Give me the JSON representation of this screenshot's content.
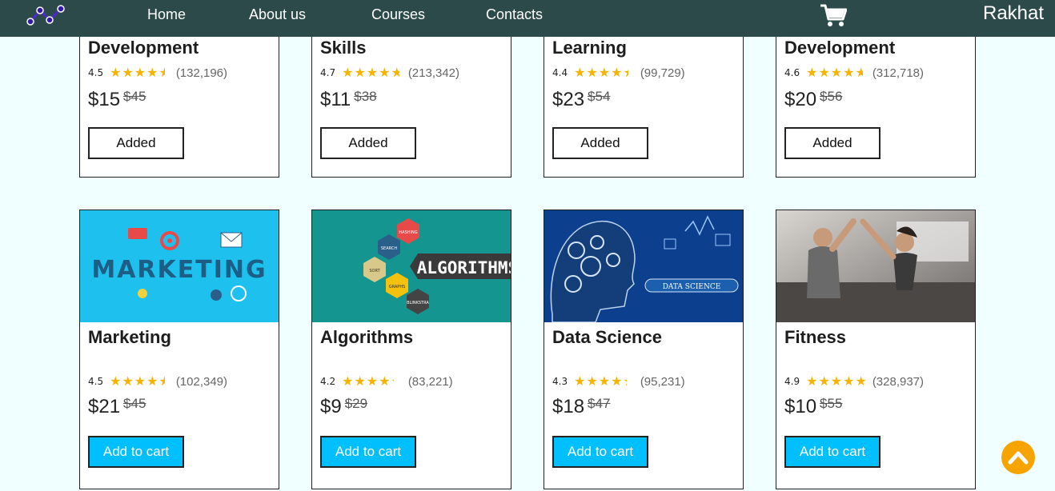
{
  "nav": {
    "logo_icon": "network-nodes-logo",
    "links": [
      "Home",
      "About us",
      "Courses",
      "Contacts"
    ],
    "cart_icon": "shopping-cart-icon",
    "user": "Rakhat"
  },
  "colors": {
    "navbar": "#2d4a4a",
    "page_bg": "#f0ffff",
    "star": "#f5b400",
    "add_button": "#00bfff",
    "scroll_button": "#f6a400"
  },
  "top_cards": [
    {
      "title": "Development",
      "rating": "4.5",
      "rating_value": 4.5,
      "count": "(132,196)",
      "price": "$15",
      "old_price": "$45",
      "button": "Added"
    },
    {
      "title": "Skills",
      "rating": "4.7",
      "rating_value": 4.7,
      "count": "(213,342)",
      "price": "$11",
      "old_price": "$38",
      "button": "Added"
    },
    {
      "title": "Learning",
      "rating": "4.4",
      "rating_value": 4.4,
      "count": "(99,729)",
      "price": "$23",
      "old_price": "$54",
      "button": "Added"
    },
    {
      "title": "Development",
      "rating": "4.6",
      "rating_value": 4.6,
      "count": "(312,718)",
      "price": "$20",
      "old_price": "$56",
      "button": "Added"
    }
  ],
  "bottom_cards": [
    {
      "image": "marketing-thumbnail",
      "image_text": "MARKETING",
      "title": "Marketing",
      "rating": "4.5",
      "rating_value": 4.5,
      "count": "(102,349)",
      "price": "$21",
      "old_price": "$45",
      "button": "Add to cart"
    },
    {
      "image": "algorithms-thumbnail",
      "image_text": "ALGORITHMS",
      "image_tags": [
        "HASHING",
        "SEARCH",
        "SORT",
        "GRAPHS",
        "BLINKSTRA"
      ],
      "title": "Algorithms",
      "rating": "4.2",
      "rating_value": 4.2,
      "count": "(83,221)",
      "price": "$9",
      "old_price": "$29",
      "button": "Add to cart"
    },
    {
      "image": "data-science-thumbnail",
      "image_text": "DATA SCIENCE",
      "title": "Data Science",
      "rating": "4.3",
      "rating_value": 4.3,
      "count": "(95,231)",
      "price": "$18",
      "old_price": "$47",
      "button": "Add to cart"
    },
    {
      "image": "fitness-thumbnail",
      "title": "Fitness",
      "rating": "4.9",
      "rating_value": 4.9,
      "count": "(328,937)",
      "price": "$10",
      "old_price": "$55",
      "button": "Add to cart"
    }
  ],
  "scroll_top_icon": "chevron-up-icon"
}
